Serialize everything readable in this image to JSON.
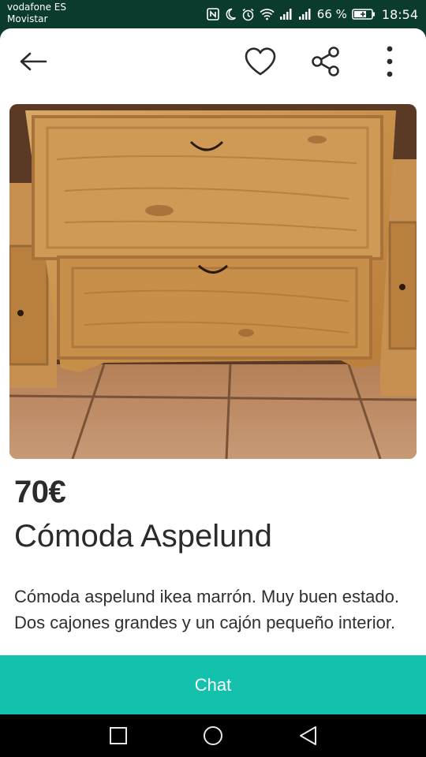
{
  "status_bar": {
    "carrier_1": "vodafone ES",
    "carrier_2": "Movistar",
    "battery": "66 %",
    "time": "18:54",
    "icons": [
      "nfc-icon",
      "moon-icon",
      "alarm-icon",
      "wifi-icon",
      "signal-icon",
      "signal-icon",
      "battery-icon"
    ]
  },
  "toolbar": {
    "icons": [
      "back-arrow-icon",
      "heart-icon",
      "share-icon",
      "more-vert-icon"
    ]
  },
  "listing": {
    "price": "70€",
    "title": "Cómoda Aspelund",
    "description": "Cómoda aspelund ikea marrón. Muy buen estado. Dos cajones grandes y un cajón pequeño interior.",
    "photo_alt": "Cómoda Aspelund"
  },
  "actions": {
    "chat_label": "Chat"
  },
  "nav_bar": {
    "icons": [
      "recents-square-icon",
      "home-circle-icon",
      "back-triangle-icon"
    ]
  },
  "colors": {
    "accent": "#13c1ac",
    "status_bar_bg": "#0b3b2e",
    "text": "#2b2b2b"
  }
}
